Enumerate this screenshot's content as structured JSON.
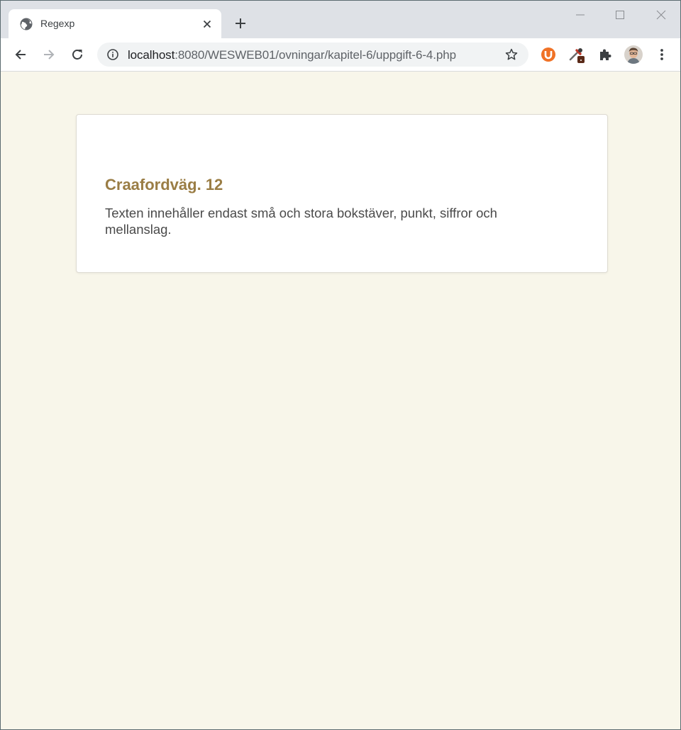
{
  "browser": {
    "tab": {
      "title": "Regexp"
    },
    "address_bar": {
      "host": "localhost",
      "path": ":8080/WESWEB01/ovningar/kapitel-6/uppgift-6-4.php"
    },
    "icons": {
      "favicon": "globe-icon",
      "tab_close": "close-icon",
      "new_tab": "plus-icon",
      "back": "arrow-left-icon",
      "forward": "arrow-right-icon",
      "reload": "reload-icon",
      "info": "info-icon",
      "bookmark": "star-icon",
      "ublock": "ublock-icon",
      "dropper": "eyedropper-icon",
      "extensions": "puzzle-icon",
      "menu": "kebab-menu-icon"
    }
  },
  "page": {
    "heading": "Craafordväg. 12",
    "message": "Texten innehåller endast små och stora bokstäver, punkt, siffror och mellanslag."
  },
  "colors": {
    "page_background": "#f8f6ea",
    "heading": "#9a7d45",
    "text": "#4a4a4a",
    "tabstrip": "#dee1e6",
    "ublock_accent": "#f07226"
  }
}
